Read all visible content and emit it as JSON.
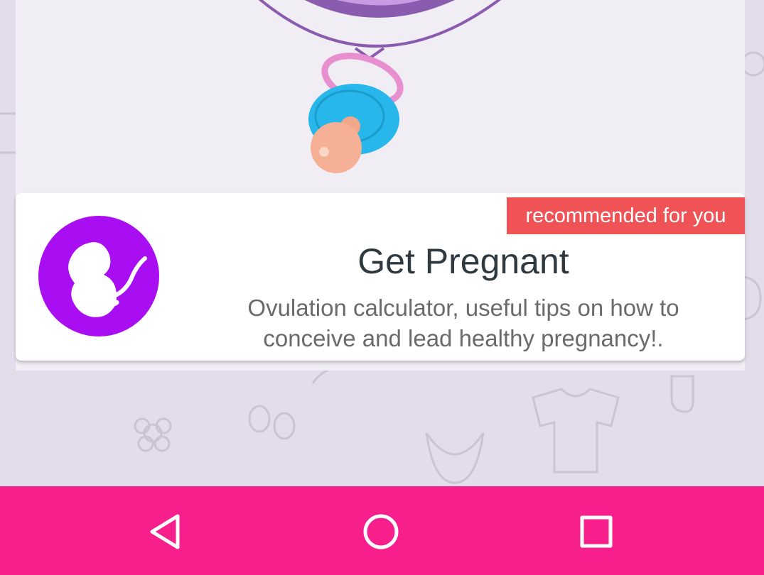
{
  "ad": {
    "badge": "recommended for you",
    "title": "Get Pregnant",
    "description_line1": "Ovulation calculator, useful tips on how to",
    "description_line2": "conceive and lead healthy pregnancy!.",
    "logo_icon": "fetus-icon"
  },
  "colors": {
    "nav_bar": "#f71f8b",
    "badge": "#ef5356",
    "logo": "#a90ef2",
    "pacifier_blue": "#27b7ea",
    "pacifier_ring": "#e88fcf",
    "clock_purple": "#8a5cb0"
  },
  "nav": {
    "back_icon": "back-triangle-icon",
    "home_icon": "home-circle-icon",
    "recents_icon": "recents-square-icon"
  }
}
